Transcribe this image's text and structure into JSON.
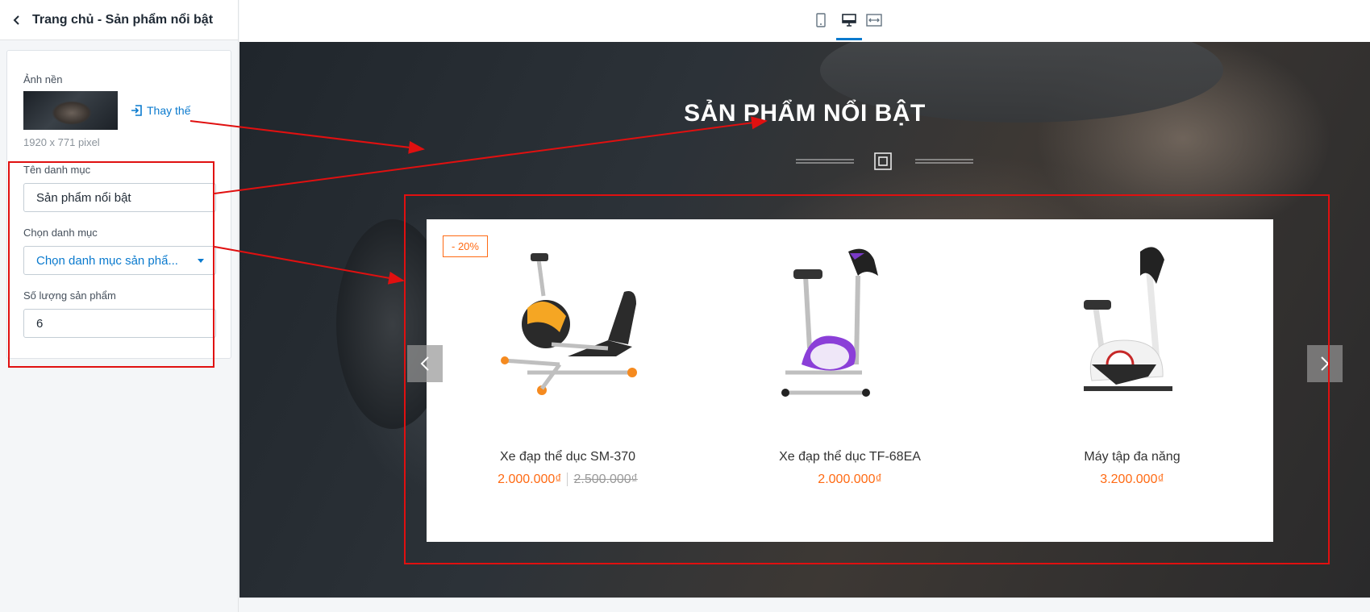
{
  "sidebar": {
    "title": "Trang chủ - Sản phẩm nổi bật",
    "background_label": "Ảnh nền",
    "replace_label": "Thay thế",
    "image_dimensions": "1920 x 771 pixel",
    "category_name_label": "Tên danh mục",
    "category_name_value": "Sản phẩm nổi bật",
    "choose_category_label": "Chọn danh mục",
    "choose_category_value": "Chọn danh mục sản phẩ...",
    "product_count_label": "Số lượng sản phẩm",
    "product_count_value": "6"
  },
  "toolbar": {
    "devices": [
      "mobile-icon",
      "desktop-icon",
      "fullwidth-icon"
    ],
    "active_device": "desktop"
  },
  "preview": {
    "section_title": "SẢN PHẨM NỔI BẬT",
    "products": [
      {
        "name": "Xe đạp thể dục SM-370",
        "price": "2.000.000₫",
        "old_price": "2.500.000₫",
        "badge": "- 20%"
      },
      {
        "name": "Xe đạp thể dục TF-68EA",
        "price": "2.000.000₫"
      },
      {
        "name": "Máy tập đa năng",
        "price": "3.200.000₫"
      }
    ]
  },
  "colors": {
    "accent": "#0a7ace",
    "price": "#ff6a13",
    "annotation": "#e01010"
  }
}
